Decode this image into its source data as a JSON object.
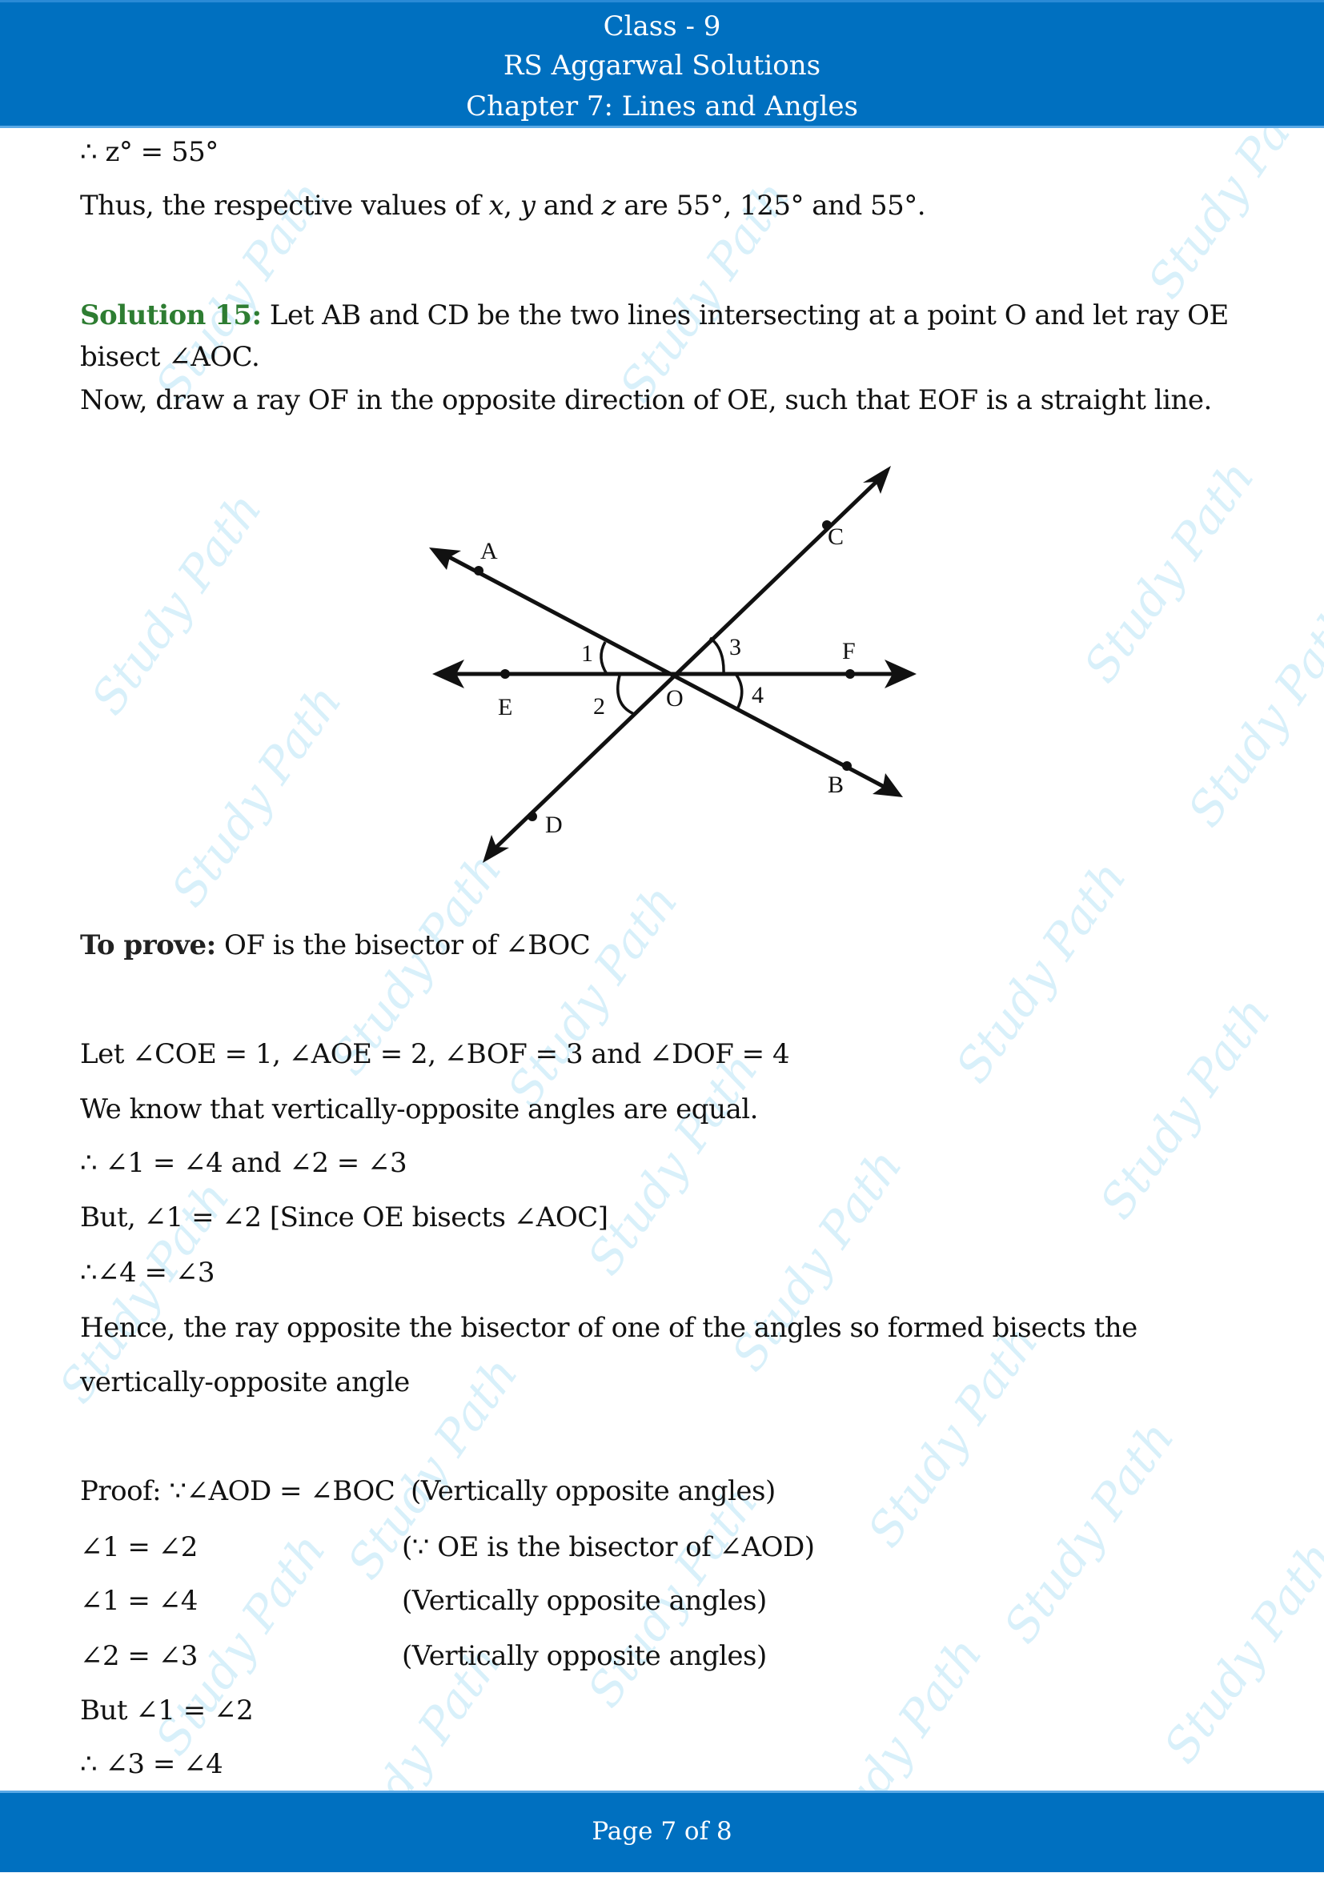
{
  "header": {
    "line1": "Class - 9",
    "line2": "RS Aggarwal Solutions",
    "line3": "Chapter 7: Lines and Angles"
  },
  "watermark_text": "Study Path",
  "prev_solution": {
    "z_result": "∴ z° = 55°",
    "summary_pre": "Thus, the respective values of ",
    "summary_x": "x",
    "summary_comma": ", ",
    "summary_y": "y",
    "summary_and": " and ",
    "summary_z": "z",
    "summary_post": " are 55°, 125° and 55°."
  },
  "solution": {
    "label": "Solution 15:",
    "intro_line1": " Let AB and CD be the two lines intersecting at a point O and let ray OE",
    "intro_line2": "bisect ∠AOC.",
    "intro_line3": "Now, draw a ray OF in the opposite direction of OE, such that EOF is a straight line.",
    "to_prove_label": "To prove:",
    "to_prove_text": " OF is the bisector of ∠BOC",
    "steps": [
      "Let ∠COE = 1, ∠AOE = 2, ∠BOF = 3 and ∠DOF = 4",
      "We know that vertically-opposite angles are equal.",
      "∴ ∠1 = ∠4 and ∠2 = ∠3",
      "But, ∠1 = ∠2 [Since OE bisects ∠AOC]",
      "∴∠4 = ∠3",
      "Hence, the ray opposite the bisector of one of the angles so formed bisects the",
      "vertically-opposite angle"
    ],
    "proof": [
      {
        "statement": "Proof: ∵∠AOD = ∠BOC",
        "reason": "(Vertically opposite angles)"
      },
      {
        "statement": "∠1 = ∠2",
        "reason": "(∵ OE is the bisector of ∠AOD)"
      },
      {
        "statement": "∠1 = ∠4",
        "reason": "(Vertically opposite angles)"
      },
      {
        "statement": "∠2 = ∠3",
        "reason": "(Vertically opposite angles)"
      },
      {
        "statement": "But ∠1 = ∠2",
        "reason": ""
      },
      {
        "statement": "∴ ∠3 = ∠4",
        "reason": ""
      }
    ]
  },
  "diagram": {
    "point_labels": {
      "A": "A",
      "B": "B",
      "C": "C",
      "D": "D",
      "E": "E",
      "F": "F",
      "O": "O"
    },
    "angle_labels": {
      "a1": "1",
      "a2": "2",
      "a3": "3",
      "a4": "4"
    }
  },
  "footer": {
    "page_prefix": "Page ",
    "page_current": "7",
    "page_of": " of ",
    "page_total": "8"
  }
}
